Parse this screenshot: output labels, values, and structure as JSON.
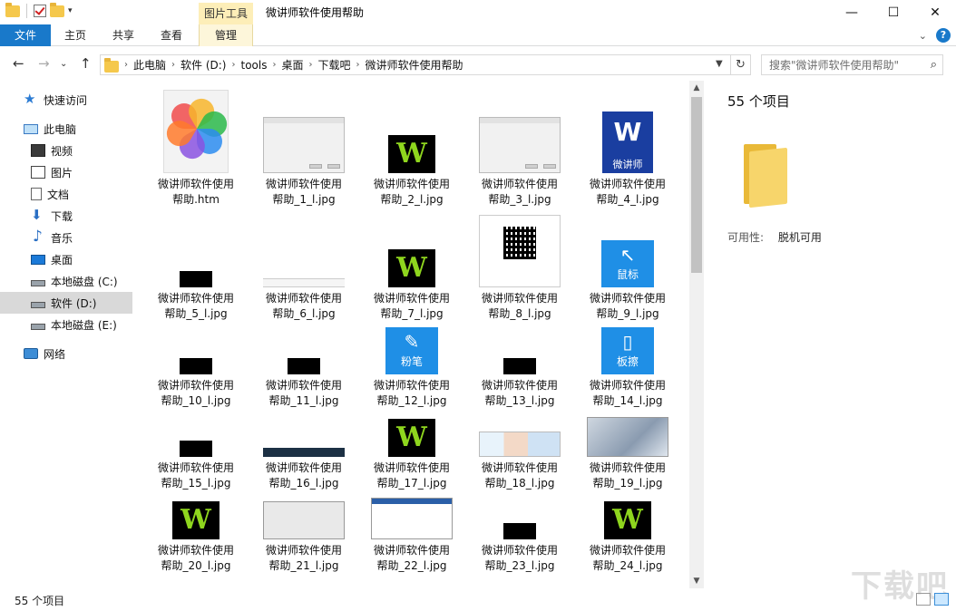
{
  "window": {
    "title": "微讲师软件使用帮助",
    "context_tab_group": "图片工具",
    "minimize_glyph": "—",
    "maximize_glyph": "☐",
    "close_glyph": "✕"
  },
  "ribbon": {
    "tabs": [
      {
        "label": "文件",
        "active": true
      },
      {
        "label": "主页"
      },
      {
        "label": "共享"
      },
      {
        "label": "查看"
      },
      {
        "label": "管理"
      }
    ],
    "collapse_glyph": "⌄",
    "help_glyph": "?"
  },
  "navigation": {
    "back_glyph": "←",
    "forward_glyph": "→",
    "recent_glyph": "⌄",
    "up_glyph": "↑",
    "breadcrumb": [
      "此电脑",
      "软件 (D:)",
      "tools",
      "桌面",
      "下载吧",
      "微讲师软件使用帮助"
    ],
    "refresh_glyph": "↻",
    "search_placeholder": "搜索\"微讲师软件使用帮助\""
  },
  "sidebar": {
    "items": [
      {
        "label": "快速访问",
        "icon": "star-icon"
      },
      {
        "label": "此电脑",
        "icon": "computer-icon"
      },
      {
        "label": "视频",
        "icon": "video-icon"
      },
      {
        "label": "图片",
        "icon": "pictures-icon"
      },
      {
        "label": "文档",
        "icon": "documents-icon"
      },
      {
        "label": "下载",
        "icon": "download-icon"
      },
      {
        "label": "音乐",
        "icon": "music-icon"
      },
      {
        "label": "桌面",
        "icon": "desktop-icon"
      },
      {
        "label": "本地磁盘 (C:)",
        "icon": "drive-icon"
      },
      {
        "label": "软件 (D:)",
        "icon": "drive-icon",
        "selected": true
      },
      {
        "label": "本地磁盘 (E:)",
        "icon": "drive-icon"
      },
      {
        "label": "网络",
        "icon": "network-icon"
      }
    ]
  },
  "files": [
    {
      "line1": "微讲师软件使用",
      "line2": "帮助.htm",
      "thumb": "htm"
    },
    {
      "line1": "微讲师软件使用",
      "line2": "帮助_1_l.jpg",
      "thumb": "dialog"
    },
    {
      "line1": "微讲师软件使用",
      "line2": "帮助_2_l.jpg",
      "thumb": "wlogo"
    },
    {
      "line1": "微讲师软件使用",
      "line2": "帮助_3_l.jpg",
      "thumb": "dialog"
    },
    {
      "line1": "微讲师软件使用",
      "line2": "帮助_4_l.jpg",
      "thumb": "wblue",
      "thumb_text": "微讲师"
    },
    {
      "line1": "微讲师软件使用",
      "line2": "帮助_5_l.jpg",
      "thumb": "black"
    },
    {
      "line1": "微讲师软件使用",
      "line2": "帮助_6_l.jpg",
      "thumb": "strip"
    },
    {
      "line1": "微讲师软件使用",
      "line2": "帮助_7_l.jpg",
      "thumb": "wlogo"
    },
    {
      "line1": "微讲师软件使用",
      "line2": "帮助_8_l.jpg",
      "thumb": "qr"
    },
    {
      "line1": "微讲师软件使用",
      "line2": "帮助_9_l.jpg",
      "thumb": "blue",
      "thumb_text": "鼠标",
      "glyph": "↖"
    },
    {
      "line1": "微讲师软件使用",
      "line2": "帮助_10_l.jpg",
      "thumb": "black"
    },
    {
      "line1": "微讲师软件使用",
      "line2": "帮助_11_l.jpg",
      "thumb": "black"
    },
    {
      "line1": "微讲师软件使用",
      "line2": "帮助_12_l.jpg",
      "thumb": "blue",
      "thumb_text": "粉笔",
      "glyph": "✎"
    },
    {
      "line1": "微讲师软件使用",
      "line2": "帮助_13_l.jpg",
      "thumb": "black"
    },
    {
      "line1": "微讲师软件使用",
      "line2": "帮助_14_l.jpg",
      "thumb": "blue",
      "thumb_text": "板擦",
      "glyph": "▯"
    },
    {
      "line1": "微讲师软件使用",
      "line2": "帮助_15_l.jpg",
      "thumb": "black"
    },
    {
      "line1": "微讲师软件使用",
      "line2": "帮助_16_l.jpg",
      "thumb": "darkstrip"
    },
    {
      "line1": "微讲师软件使用",
      "line2": "帮助_17_l.jpg",
      "thumb": "wlogo"
    },
    {
      "line1": "微讲师软件使用",
      "line2": "帮助_18_l.jpg",
      "thumb": "collage"
    },
    {
      "line1": "微讲师软件使用",
      "line2": "帮助_19_l.jpg",
      "thumb": "photo"
    },
    {
      "line1": "微讲师软件使用",
      "line2": "帮助_20_l.jpg",
      "thumb": "wlogo"
    },
    {
      "line1": "微讲师软件使用",
      "line2": "帮助_21_l.jpg",
      "thumb": "screen"
    },
    {
      "line1": "微讲师软件使用",
      "line2": "帮助_22_l.jpg",
      "thumb": "window"
    },
    {
      "line1": "微讲师软件使用",
      "line2": "帮助_23_l.jpg",
      "thumb": "black"
    },
    {
      "line1": "微讲师软件使用",
      "line2": "帮助_24_l.jpg",
      "thumb": "wlogo"
    }
  ],
  "logo_letter": "W",
  "scrollbar": {
    "up_glyph": "▲",
    "down_glyph": "▼"
  },
  "details": {
    "item_count": "55 个项目",
    "availability_key": "可用性:",
    "availability_value": "脱机可用"
  },
  "status": {
    "item_count": "55 个项目"
  },
  "watermark": "下载吧",
  "colors": {
    "accent": "#1979ca",
    "context_tab": "#fdeeb8",
    "selection": "#d9d9d9"
  }
}
